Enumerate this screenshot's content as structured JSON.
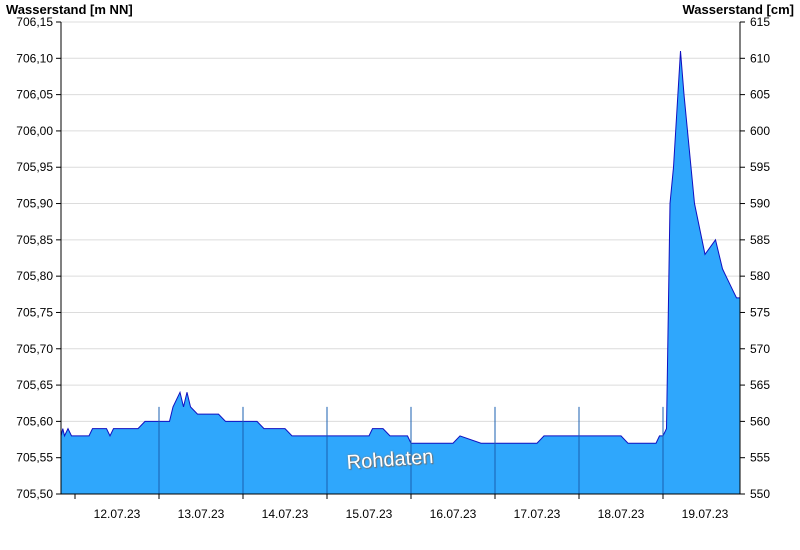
{
  "chart_data": {
    "type": "area",
    "ylabel_left": "Wasserstand [m NN]",
    "ylabel_right": "Wasserstand [cm]",
    "watermark": "Rohdaten",
    "x_start": "2023-07-11T20:00",
    "x_end": "2023-07-19T22:00",
    "xticks": [
      "12.07.23",
      "13.07.23",
      "14.07.23",
      "15.07.23",
      "16.07.23",
      "17.07.23",
      "18.07.23",
      "19.07.23"
    ],
    "ylim_left": [
      705.5,
      706.15
    ],
    "ylim_right": [
      550,
      615
    ],
    "yticks_left": [
      "705,50",
      "705,55",
      "705,60",
      "705,65",
      "705,70",
      "705,75",
      "705,80",
      "705,85",
      "705,90",
      "705,95",
      "706,00",
      "706,05",
      "706,10",
      "706,15"
    ],
    "yticks_right": [
      "550",
      "555",
      "560",
      "565",
      "570",
      "575",
      "580",
      "585",
      "590",
      "595",
      "600",
      "605",
      "610",
      "615"
    ],
    "grid": true,
    "colors": {
      "fill": "#2fa7fc",
      "line": "#1010c0",
      "grid": "#dcdcdc",
      "divider": "#1a5fb0"
    },
    "series": [
      {
        "x": [
          "2023-07-11T20:00",
          "2023-07-11T20:30",
          "2023-07-11T21:00",
          "2023-07-11T22:00",
          "2023-07-11T23:00",
          "2023-07-12T00:00",
          "2023-07-12T04:00",
          "2023-07-12T05:00",
          "2023-07-12T09:00",
          "2023-07-12T10:00",
          "2023-07-12T11:00",
          "2023-07-12T18:00",
          "2023-07-12T20:00",
          "2023-07-13T03:00",
          "2023-07-13T04:00",
          "2023-07-13T06:00",
          "2023-07-13T07:00",
          "2023-07-13T08:00",
          "2023-07-13T09:00",
          "2023-07-13T11:00",
          "2023-07-13T12:00",
          "2023-07-13T17:00",
          "2023-07-13T19:00",
          "2023-07-14T04:00",
          "2023-07-14T06:00",
          "2023-07-14T12:00",
          "2023-07-14T14:00",
          "2023-07-14T20:00",
          "2023-07-15T12:00",
          "2023-07-15T13:00",
          "2023-07-15T16:00",
          "2023-07-15T18:00",
          "2023-07-15T23:00",
          "2023-07-16T00:00",
          "2023-07-16T12:00",
          "2023-07-16T14:00",
          "2023-07-16T20:00",
          "2023-07-17T00:00",
          "2023-07-17T12:00",
          "2023-07-17T14:00",
          "2023-07-18T12:00",
          "2023-07-18T14:00",
          "2023-07-18T22:00",
          "2023-07-18T23:00",
          "2023-07-19T00:00",
          "2023-07-19T01:00",
          "2023-07-19T02:00",
          "2023-07-19T03:00",
          "2023-07-19T05:00",
          "2023-07-19T06:00",
          "2023-07-19T08:00",
          "2023-07-19T09:00",
          "2023-07-19T12:00",
          "2023-07-19T15:00",
          "2023-07-19T17:00",
          "2023-07-19T18:00",
          "2023-07-19T20:00",
          "2023-07-19T21:00",
          "2023-07-19T22:00"
        ],
        "y": [
          705.58,
          705.59,
          705.58,
          705.59,
          705.58,
          705.58,
          705.58,
          705.59,
          705.59,
          705.58,
          705.59,
          705.59,
          705.6,
          705.6,
          705.62,
          705.64,
          705.62,
          705.64,
          705.62,
          705.61,
          705.61,
          705.61,
          705.6,
          705.6,
          705.59,
          705.59,
          705.58,
          705.58,
          705.58,
          705.59,
          705.59,
          705.58,
          705.58,
          705.57,
          705.57,
          705.58,
          705.57,
          705.57,
          705.57,
          705.58,
          705.58,
          705.57,
          705.57,
          705.58,
          705.58,
          705.59,
          705.9,
          705.95,
          706.11,
          706.05,
          705.95,
          705.9,
          705.83,
          705.85,
          705.81,
          705.8,
          705.78,
          705.77,
          705.77
        ]
      }
    ]
  }
}
